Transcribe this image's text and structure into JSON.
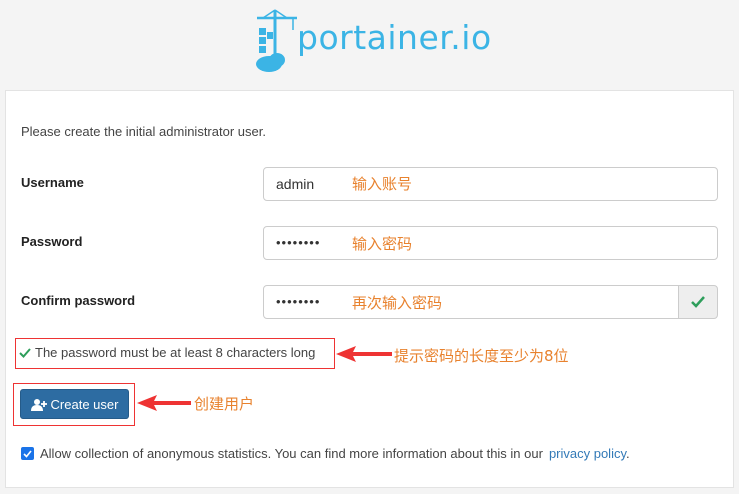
{
  "logo": {
    "text": "portainer.io"
  },
  "form": {
    "intro": "Please create the initial administrator user.",
    "username": {
      "label": "Username",
      "value": "admin"
    },
    "password": {
      "label": "Password",
      "value": "••••••••"
    },
    "confirm": {
      "label": "Confirm password",
      "value": "••••••••"
    },
    "hint": "The password must be at least 8 characters long",
    "submit_label": "Create user",
    "stats_text": "Allow collection of anonymous statistics. You can find more information about this in our",
    "stats_link": "privacy policy",
    "stats_period": ".",
    "stats_checked": true
  },
  "annotations": {
    "username_note": "输入账号",
    "password_note": "输入密码",
    "confirm_note": "再次输入密码",
    "hint_note": "提示密码的长度至少为8位",
    "button_note": "创建用户",
    "color": "#e8822e",
    "arrow_color": "#e33"
  },
  "colors": {
    "brand": "#3bb4e5",
    "button": "#2d6ca2",
    "check": "#2e9e5b"
  }
}
